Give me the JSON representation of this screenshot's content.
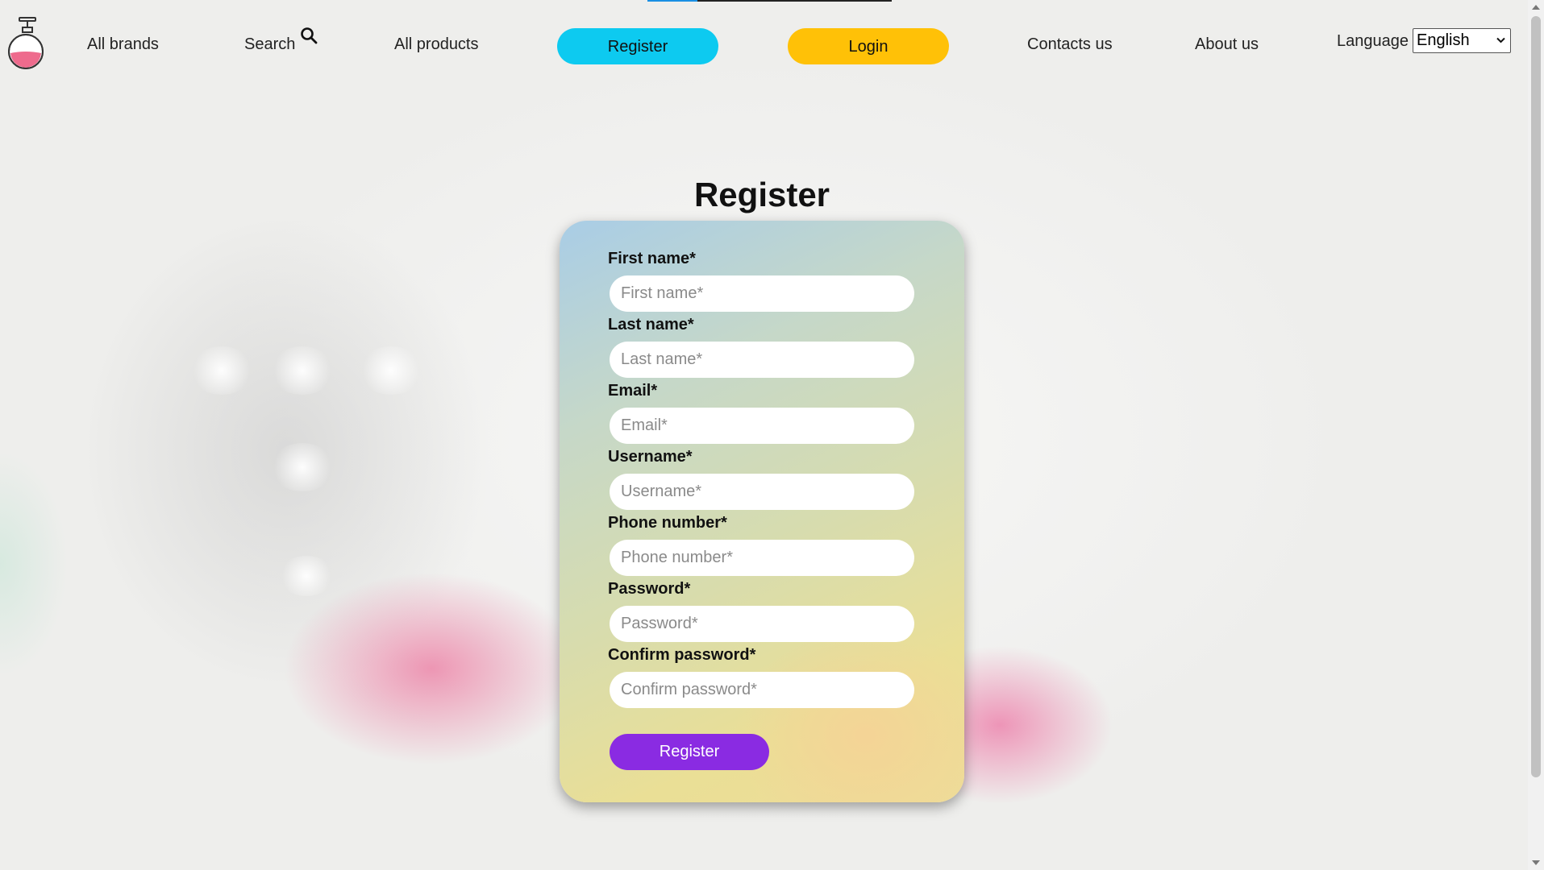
{
  "nav": {
    "all_brands": "All brands",
    "search": "Search",
    "all_products": "All products",
    "register": "Register",
    "login": "Login",
    "contacts": "Contacts us",
    "about": "About us",
    "language_label": "Language",
    "language_selected": "English"
  },
  "icons": {
    "logo": "perfume-bottle-icon",
    "search": "search-icon",
    "dropdown": "chevron-down-icon"
  },
  "colors": {
    "register_button": "#0dcaf0",
    "login_button": "#ffc107",
    "submit_button": "#8a2be2"
  },
  "form": {
    "title": "Register",
    "fields": [
      {
        "label": "First name*",
        "placeholder": "First name*"
      },
      {
        "label": "Last name*",
        "placeholder": "Last name*"
      },
      {
        "label": "Email*",
        "placeholder": "Email*"
      },
      {
        "label": "Username*",
        "placeholder": "Username*"
      },
      {
        "label": "Phone number*",
        "placeholder": "Phone number*"
      },
      {
        "label": "Password*",
        "placeholder": "Password*"
      },
      {
        "label": "Confirm password*",
        "placeholder": "Confirm password*"
      }
    ],
    "submit": "Register"
  }
}
